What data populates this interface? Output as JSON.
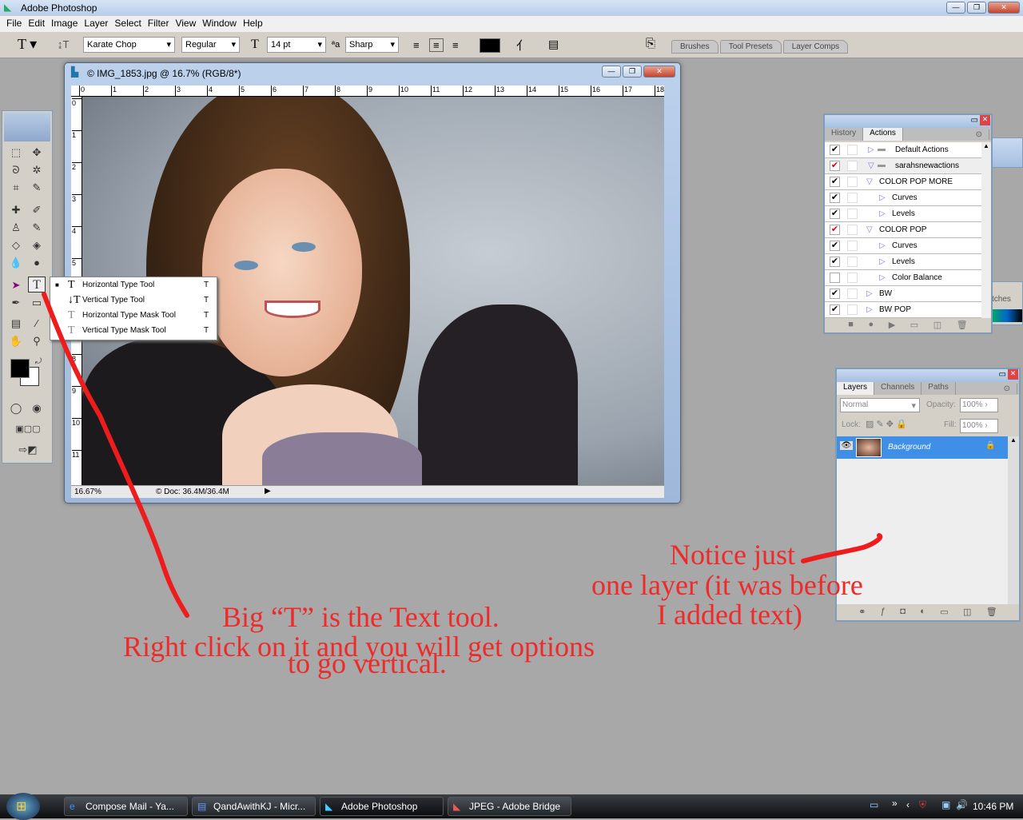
{
  "app": {
    "title": "Adobe Photoshop"
  },
  "menu": [
    "File",
    "Edit",
    "Image",
    "Layer",
    "Select",
    "Filter",
    "View",
    "Window",
    "Help"
  ],
  "options": {
    "font_family": "Karate Chop",
    "font_style": "Regular",
    "font_size": "14 pt",
    "antialias": "Sharp",
    "color": "#000000"
  },
  "palette_tabs": [
    "Brushes",
    "Tool Presets",
    "Layer Comps"
  ],
  "document": {
    "title": "© IMG_1853.jpg @ 16.7% (RGB/8*)",
    "zoom": "16.67%",
    "doc_info": "© Doc: 36.4M/36.4M",
    "ruler_h": [
      "0",
      "1",
      "2",
      "3",
      "4",
      "5",
      "6",
      "7",
      "8",
      "9",
      "10",
      "11",
      "12",
      "13",
      "14",
      "15",
      "16",
      "17",
      "18"
    ],
    "ruler_v": [
      "0",
      "1",
      "2",
      "3",
      "4",
      "5",
      "6",
      "7",
      "8",
      "9",
      "10",
      "11"
    ]
  },
  "flyout": [
    {
      "label": "Horizontal Type Tool",
      "key": "T",
      "selected": true
    },
    {
      "label": "Vertical Type Tool",
      "key": "T"
    },
    {
      "label": "Horizontal Type Mask Tool",
      "key": "T"
    },
    {
      "label": "Vertical Type Mask Tool",
      "key": "T"
    }
  ],
  "actions_panel": {
    "tabs": [
      "History",
      "Actions"
    ],
    "rows": [
      {
        "label": "Default Actions",
        "check": "black",
        "indent": 0,
        "folder": true,
        "open": false
      },
      {
        "label": "sarahsnewactions",
        "check": "red",
        "indent": 0,
        "folder": true,
        "open": true
      },
      {
        "label": "COLOR POP MORE",
        "check": "black",
        "indent": 1,
        "open": true
      },
      {
        "label": "Curves",
        "check": "black",
        "indent": 2,
        "open": false
      },
      {
        "label": "Levels",
        "check": "black",
        "indent": 2,
        "open": false
      },
      {
        "label": "COLOR POP",
        "check": "red",
        "indent": 1,
        "open": true
      },
      {
        "label": "Curves",
        "check": "black",
        "indent": 2,
        "open": false
      },
      {
        "label": "Levels",
        "check": "black",
        "indent": 2,
        "open": false
      },
      {
        "label": "Color Balance",
        "check": "none",
        "indent": 2,
        "open": false
      },
      {
        "label": "BW",
        "check": "black",
        "indent": 1,
        "open": false
      },
      {
        "label": "BW POP",
        "check": "black",
        "indent": 1,
        "open": false
      }
    ]
  },
  "swatches_partial": "tches",
  "layers_panel": {
    "tabs": [
      "Layers",
      "Channels",
      "Paths"
    ],
    "blend": "Normal",
    "opacity_label": "Opacity:",
    "opacity": "100%",
    "lock_label": "Lock:",
    "fill_label": "Fill:",
    "fill": "100%",
    "layers": [
      {
        "name": "Background",
        "visible": true,
        "locked": true
      }
    ]
  },
  "annotations": {
    "line1": "Big “T” is the Text tool.",
    "line2": "Right click on it and you will get options",
    "line3": "to go vertical.",
    "note1": "Notice just",
    "note2": "one layer (it was before",
    "note3": "I added text)",
    "color": "#ee2a2a"
  },
  "taskbar": {
    "items": [
      "Compose Mail - Ya...",
      "QandAwithKJ - Micr...",
      "Adobe Photoshop",
      "JPEG - Adobe Bridge"
    ],
    "active": 2,
    "clock": "10:46 PM"
  }
}
